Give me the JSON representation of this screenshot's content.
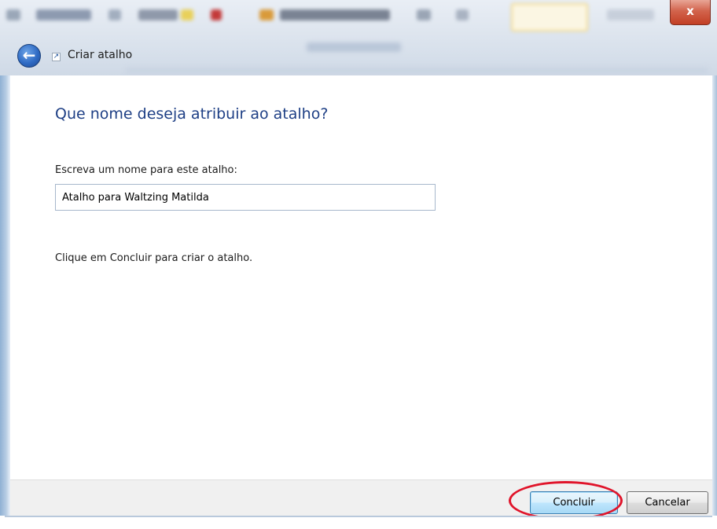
{
  "window": {
    "title": "Criar atalho",
    "close_label": "x"
  },
  "wizard": {
    "heading": "Que nome deseja atribuir ao atalho?",
    "field_label": "Escreva um nome para este atalho:",
    "name_value": "Atalho para Waltzing Matilda",
    "instruction": "Clique em Concluir para criar o atalho."
  },
  "buttons": {
    "finish_label": "Concluir",
    "cancel_label": "Cancelar"
  },
  "icons": {
    "back": "back-arrow-icon",
    "shortcut": "shortcut-icon",
    "close": "close-icon"
  },
  "colors": {
    "heading": "#1e3f85",
    "highlight": "#e0142a",
    "close_button": "#c23f24"
  }
}
